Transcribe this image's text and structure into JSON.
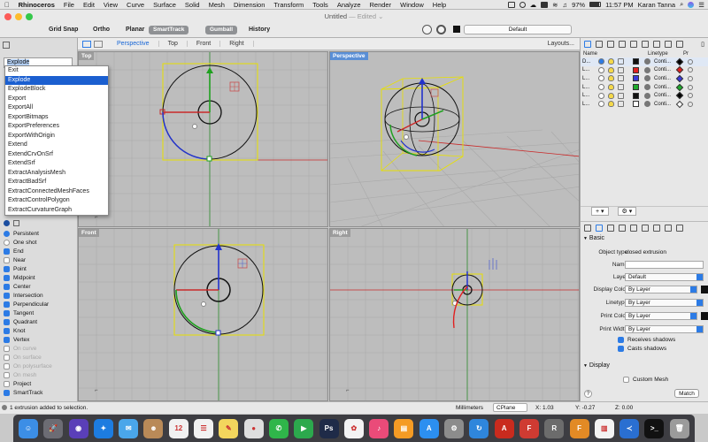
{
  "menubar": {
    "apple": "",
    "app_name": "Rhinoceros",
    "items": [
      "File",
      "Edit",
      "View",
      "Curve",
      "Surface",
      "Solid",
      "Mesh",
      "Dimension",
      "Transform",
      "Tools",
      "Analyze",
      "Render",
      "Window",
      "Help"
    ],
    "battery": "97%",
    "time": "11:57 PM",
    "user": "Karan Tanna"
  },
  "window": {
    "title": "Untitled",
    "edited": "— Edited ⌄"
  },
  "toolbar": {
    "grid_snap": "Grid Snap",
    "ortho": "Ortho",
    "planar": "Planar",
    "smarttrack": "SmartTrack",
    "gumball": "Gumball",
    "history": "History",
    "layer_value": "Default"
  },
  "viewport_tabs": {
    "tabs": [
      "Perspective",
      "Top",
      "Front",
      "Right"
    ],
    "layouts": "Layouts..."
  },
  "command": {
    "typed": "Explode",
    "options": [
      "Exit",
      "Explode",
      "ExplodeBlock",
      "Export",
      "ExportAll",
      "ExportBitmaps",
      "ExportPreferences",
      "ExportWithOrigin",
      "Extend",
      "ExtendCrvOnSrf",
      "ExtendSrf",
      "ExtractAnalysisMesh",
      "ExtractBadSrf",
      "ExtractConnectedMeshFaces",
      "ExtractControlPolygon",
      "ExtractCurvatureGraph"
    ],
    "highlighted_index": 1
  },
  "osnap": {
    "mode": [
      {
        "label": "Persistent",
        "on": true
      },
      {
        "label": "One shot",
        "on": false
      }
    ],
    "items": [
      {
        "label": "End",
        "on": true,
        "enabled": true
      },
      {
        "label": "Near",
        "on": false,
        "enabled": true
      },
      {
        "label": "Point",
        "on": true,
        "enabled": true
      },
      {
        "label": "Midpoint",
        "on": true,
        "enabled": true
      },
      {
        "label": "Center",
        "on": true,
        "enabled": true
      },
      {
        "label": "Intersection",
        "on": true,
        "enabled": true
      },
      {
        "label": "Perpendicular",
        "on": true,
        "enabled": true
      },
      {
        "label": "Tangent",
        "on": true,
        "enabled": true
      },
      {
        "label": "Quadrant",
        "on": true,
        "enabled": true
      },
      {
        "label": "Knot",
        "on": true,
        "enabled": true
      },
      {
        "label": "Vertex",
        "on": true,
        "enabled": true
      },
      {
        "label": "On curve",
        "on": false,
        "enabled": false
      },
      {
        "label": "On surface",
        "on": false,
        "enabled": false
      },
      {
        "label": "On polysurface",
        "on": false,
        "enabled": false
      },
      {
        "label": "On mesh",
        "on": false,
        "enabled": false
      },
      {
        "label": "Project",
        "on": false,
        "enabled": true
      },
      {
        "label": "SmartTrack",
        "on": true,
        "enabled": true
      }
    ]
  },
  "viewports": {
    "top": "Top",
    "perspective": "Perspective",
    "front": "Front",
    "right": "Right"
  },
  "layers": {
    "header_name": "Name",
    "header_linetype": "Linetype",
    "header_p": "Pr",
    "rows": [
      {
        "name": "D...",
        "color": "#111111",
        "linetype": "Conti...",
        "pcolor": "#000000"
      },
      {
        "name": "L...",
        "color": "#e02020",
        "linetype": "Conti...",
        "pcolor": "#e02020"
      },
      {
        "name": "L...",
        "color": "#3a3ad8",
        "linetype": "Conti...",
        "pcolor": "#3a3ad8"
      },
      {
        "name": "L...",
        "color": "#1faa2c",
        "linetype": "Conti...",
        "pcolor": "#1faa2c"
      },
      {
        "name": "L...",
        "color": "#111111",
        "linetype": "Conti...",
        "pcolor": "#000000"
      },
      {
        "name": "L...",
        "color": "#ffffff",
        "linetype": "Conti...",
        "pcolor": "#ffffff"
      }
    ]
  },
  "properties": {
    "section_basic": "Basic",
    "object_type_label": "Object type:",
    "object_type_value": "closed extrusion",
    "name_label": "Name:",
    "layer_label": "Layer:",
    "layer_value": "Default",
    "display_color_label": "Display Color:",
    "display_color_value": "By Layer",
    "linetype_label": "Linetype:",
    "linetype_value": "By Layer",
    "print_color_label": "Print Color:",
    "print_color_value": "By Layer",
    "print_width_label": "Print Width:",
    "print_width_value": "By Layer",
    "receives_shadows": "Receives shadows",
    "casts_shadows": "Casts shadows",
    "section_display": "Display",
    "custom_mesh": "Custom Mesh",
    "help": "?",
    "match": "Match"
  },
  "status": {
    "message": "1 extrusion added to selection.",
    "units": "Millimeters",
    "cplane": "CPlane",
    "x": "X: 1.03",
    "y": "Y: -0.27",
    "z": "Z: 0.00"
  },
  "dock": {
    "apps": [
      {
        "name": "finder",
        "color": "#3c8ee6",
        "glyph": "☺"
      },
      {
        "name": "launchpad",
        "color": "#6c6c74",
        "glyph": "🚀"
      },
      {
        "name": "siri",
        "color": "#5a3fb8",
        "glyph": "◉"
      },
      {
        "name": "safari",
        "color": "#1d7ce0",
        "glyph": "✦"
      },
      {
        "name": "mail",
        "color": "#4aa6ea",
        "glyph": "✉"
      },
      {
        "name": "contacts",
        "color": "#b98a58",
        "glyph": "☻"
      },
      {
        "name": "calendar",
        "color": "#f1f1f1",
        "glyph": "12"
      },
      {
        "name": "reminders",
        "color": "#f1f1f1",
        "glyph": "☰"
      },
      {
        "name": "notes",
        "color": "#f3d65d",
        "glyph": "✎"
      },
      {
        "name": "chrome",
        "color": "#dedede",
        "glyph": "●"
      },
      {
        "name": "messages",
        "color": "#2fb64a",
        "glyph": "✆"
      },
      {
        "name": "facetime",
        "color": "#2ca94d",
        "glyph": "▶"
      },
      {
        "name": "photoshop",
        "color": "#1f2b48",
        "glyph": "Ps"
      },
      {
        "name": "photos",
        "color": "#f3f3f3",
        "glyph": "✿"
      },
      {
        "name": "itunes",
        "color": "#ea4b79",
        "glyph": "♪"
      },
      {
        "name": "ibooks",
        "color": "#f59b24",
        "glyph": "▤"
      },
      {
        "name": "app-store",
        "color": "#2c8ff0",
        "glyph": "A"
      },
      {
        "name": "system-preferences",
        "color": "#8c8c8c",
        "glyph": "⚙"
      },
      {
        "name": "sync",
        "color": "#2f86dc",
        "glyph": "↻"
      },
      {
        "name": "acrobat",
        "color": "#c92b1e",
        "glyph": "A"
      },
      {
        "name": "autodesk",
        "color": "#cf3b32",
        "glyph": "F"
      },
      {
        "name": "rhinoceros",
        "color": "#6c6c6c",
        "glyph": "R"
      },
      {
        "name": "fusion",
        "color": "#e28a25",
        "glyph": "F"
      },
      {
        "name": "files",
        "color": "#f3f3f3",
        "glyph": "▥"
      },
      {
        "name": "vscode",
        "color": "#2a6fd1",
        "glyph": "≺"
      },
      {
        "name": "terminal",
        "color": "#111111",
        "glyph": ">_"
      },
      {
        "name": "trash",
        "color": "#9b9b9b",
        "glyph": "🗑"
      }
    ]
  }
}
